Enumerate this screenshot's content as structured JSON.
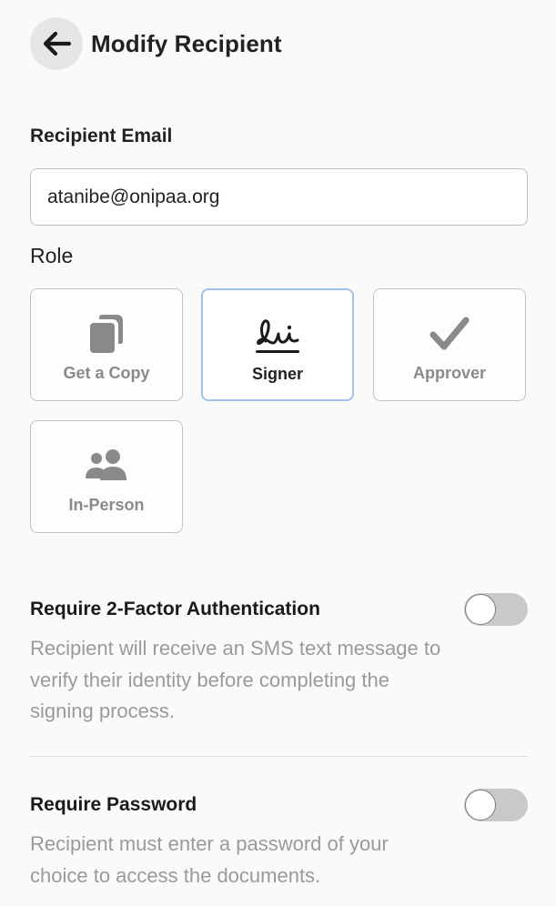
{
  "header": {
    "title": "Modify Recipient",
    "back_icon": "arrow-left-icon"
  },
  "email": {
    "label": "Recipient Email",
    "value": "atanibe@onipaa.org",
    "placeholder": ""
  },
  "role": {
    "label": "Role",
    "selected": "Signer",
    "options": [
      {
        "label": "Get a Copy",
        "icon": "copy-icon",
        "selected": false
      },
      {
        "label": "Signer",
        "icon": "signature-icon",
        "selected": true
      },
      {
        "label": "Approver",
        "icon": "checkmark-icon",
        "selected": false
      },
      {
        "label": "In-Person",
        "icon": "people-icon",
        "selected": false
      }
    ]
  },
  "settings": {
    "two_factor": {
      "title": "Require 2-Factor Authentication",
      "description": "Recipient will receive an SMS text message to verify their identity before completing the signing process.",
      "enabled": false
    },
    "password": {
      "title": "Require Password",
      "description": "Recipient must enter a password of your choice to access the documents.",
      "enabled": false
    }
  },
  "colors": {
    "background": "#fafafa",
    "selected_border": "#9fc3ee",
    "muted_text": "#9a9a9a",
    "toggle_off": "#c9c9c9"
  }
}
